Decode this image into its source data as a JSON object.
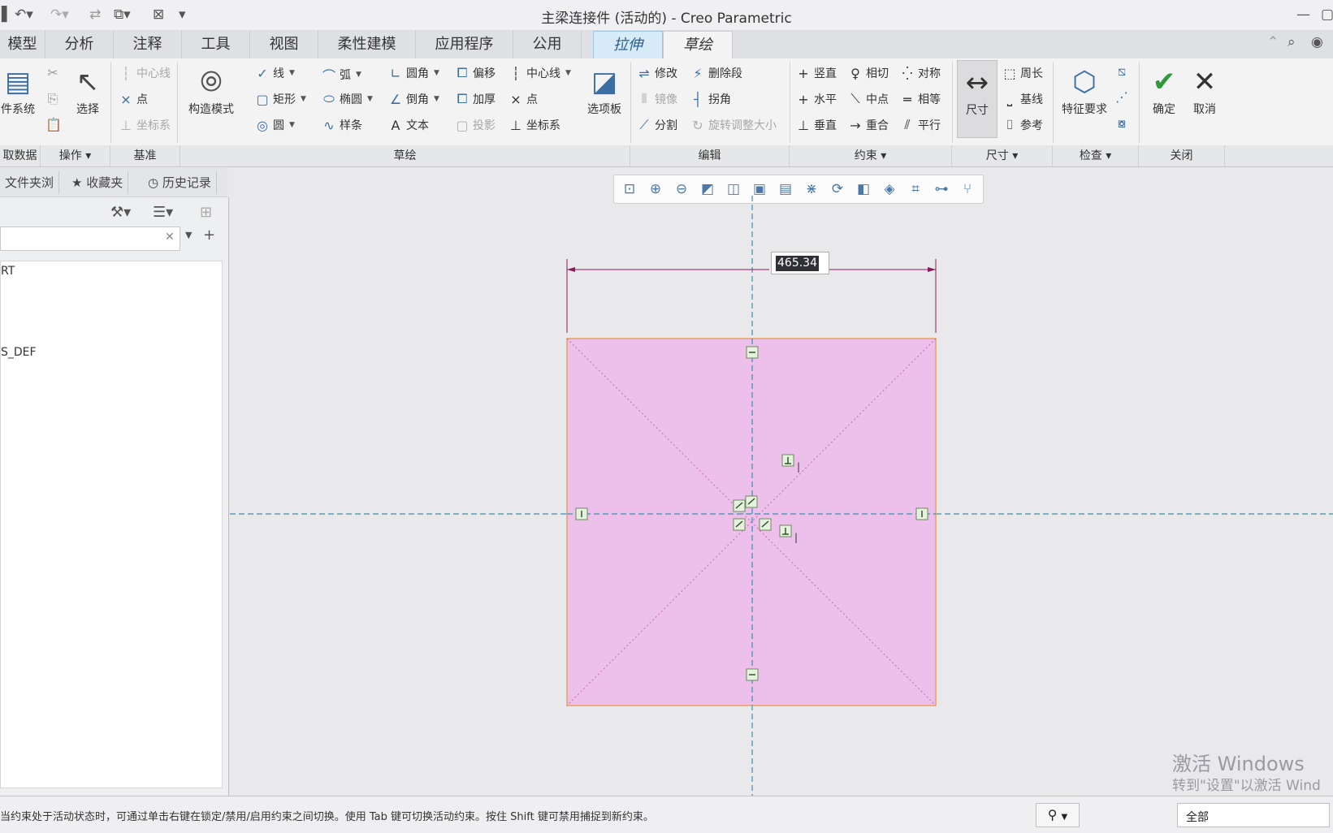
{
  "window": {
    "title": "主梁连接件 (活动的) - Creo Parametric"
  },
  "tabs": [
    {
      "label": "模型"
    },
    {
      "label": "分析"
    },
    {
      "label": "注释"
    },
    {
      "label": "工具"
    },
    {
      "label": "视图"
    },
    {
      "label": "柔性建模"
    },
    {
      "label": "应用程序"
    },
    {
      "label": "公用"
    },
    {
      "label": "拉伸"
    },
    {
      "label": "草绘"
    }
  ],
  "ribbon": {
    "groups": {
      "get_data": "取数据",
      "operations": "操作",
      "datum": "基准",
      "sketch": "草绘",
      "edit": "编辑",
      "constrain": "约束",
      "dimension": "尺寸",
      "inspect": "检查",
      "close": "关闭"
    },
    "file_system": "件系统",
    "select": "选择",
    "datum": {
      "centerline": "中心线",
      "point": "点",
      "coord": "坐标系"
    },
    "construction_mode": "构造模式",
    "sketch": {
      "line": "线",
      "rectangle": "矩形",
      "circle": "圆",
      "arc": "弧",
      "ellipse": "椭圆",
      "spline": "样条",
      "fillet": "圆角",
      "chamfer": "倒角",
      "text": "文本",
      "offset": "偏移",
      "thicken": "加厚",
      "project": "投影",
      "centerline": "中心线",
      "point": "点",
      "coord": "坐标系",
      "palette": "选项板"
    },
    "edit": {
      "modify": "修改",
      "delete_segment": "删除段",
      "mirror": "镜像",
      "corner": "拐角",
      "divide": "分割",
      "rotate_resize": "旋转调整大小"
    },
    "constrain": {
      "vertical": "竖直",
      "tangent": "相切",
      "symmetric": "对称",
      "horizontal": "水平",
      "midpoint": "中点",
      "equal": "相等",
      "perpendicular": "垂直",
      "coincident": "重合",
      "parallel": "平行"
    },
    "dimension": {
      "dimension": "尺寸",
      "perimeter": "周长",
      "baseline": "基线",
      "reference": "参考"
    },
    "inspect": {
      "feature_req": "特征要求"
    },
    "close": {
      "ok": "确定",
      "cancel": "取消"
    }
  },
  "left_panel": {
    "tabs": [
      "文件夹浏",
      "收藏夹",
      "历史记录"
    ],
    "tree_items": [
      "RT",
      "S_DEF"
    ]
  },
  "canvas": {
    "dimension_value": "465.34",
    "watermark_title": "激活 Windows",
    "watermark_sub": "转到\"设置\"以激活 Wind"
  },
  "status": {
    "message": "当约束处于活动状态时，可通过单击右键在锁定/禁用/启用约束之间切换。使用 Tab 键可切换活动约束。按住 Shift 键可禁用捕捉到新约束。",
    "filter_value": "全部"
  },
  "colors": {
    "sketch_fill": "#ecc0ea",
    "sketch_edge": "#e8a060",
    "dimension_line": "#8b1a5a",
    "center_line": "#3a8fb0"
  }
}
